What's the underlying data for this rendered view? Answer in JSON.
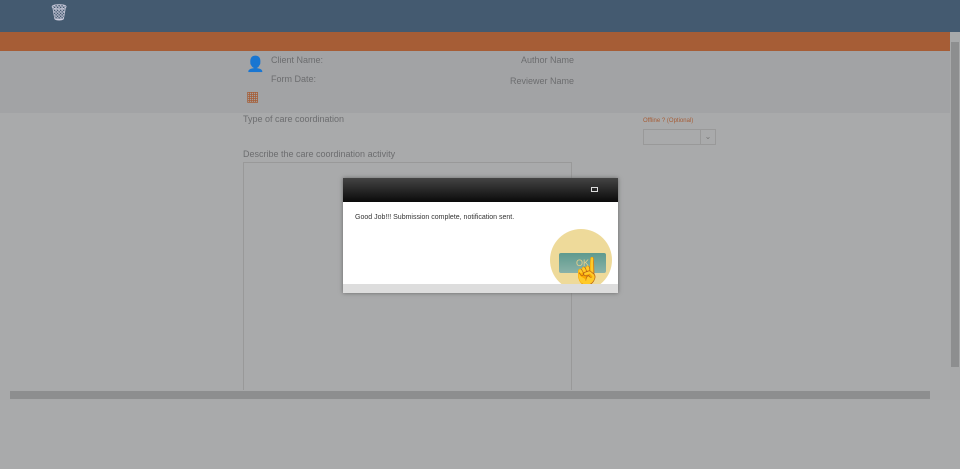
{
  "toolbar": {
    "trash_icon": "trash-icon"
  },
  "header": {
    "client_name_label": "Client Name:",
    "form_date_label": "Form Date:",
    "author_name": "Author Name",
    "reviewer_name": "Reviewer Name"
  },
  "form": {
    "type_label": "Type of care coordination",
    "offline_label": "Offline ? (Optional)",
    "offline_value": "",
    "describe_label": "Describe the care coordination activity",
    "describe_value": ""
  },
  "dialog": {
    "message": "Good Job!!! Submission complete, notification sent.",
    "ok_label": "OK"
  },
  "colors": {
    "topbar": "#445a70",
    "accent": "#a65d36",
    "ok_button": "#6fa398"
  }
}
